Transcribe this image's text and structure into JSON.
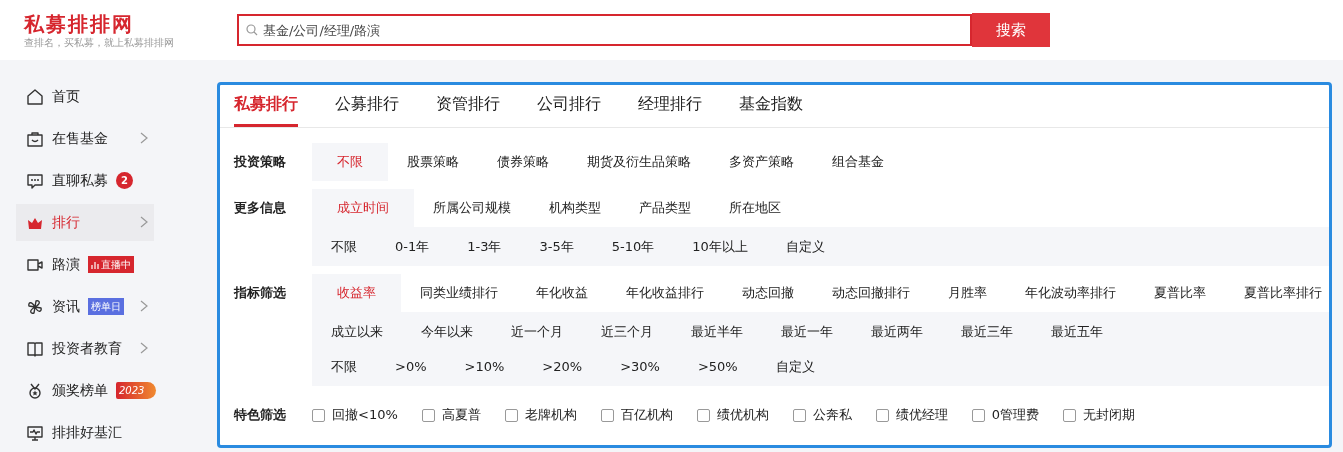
{
  "logo": {
    "title": "私募排排网",
    "slogan": "查排名，买私募，就上私募排排网"
  },
  "search": {
    "placeholder": "基金/公司/经理/路演",
    "button": "搜索"
  },
  "sidebar": {
    "items": [
      {
        "label": "首页",
        "kind": "home",
        "chevron": false,
        "selected": false
      },
      {
        "label": "在售基金",
        "kind": "bag",
        "chevron": true,
        "selected": false
      },
      {
        "label": "直聊私募",
        "kind": "chat",
        "chevron": false,
        "selected": false,
        "badge": {
          "kind": "count",
          "text": "2"
        }
      },
      {
        "label": "排行",
        "kind": "crown",
        "chevron": true,
        "selected": true
      },
      {
        "label": "路演",
        "kind": "camera",
        "chevron": false,
        "selected": false,
        "badge": {
          "kind": "live",
          "text": "直播中"
        }
      },
      {
        "label": "资讯",
        "kind": "pinwheel",
        "chevron": true,
        "selected": false,
        "badge": {
          "kind": "tag",
          "text": "榜单日"
        }
      },
      {
        "label": "投资者教育",
        "kind": "book",
        "chevron": true,
        "selected": false
      },
      {
        "label": "颁奖榜单",
        "kind": "medal",
        "chevron": false,
        "selected": false,
        "badge": {
          "kind": "year",
          "text": "2023"
        }
      },
      {
        "label": "排排好基汇",
        "kind": "monitor",
        "chevron": false,
        "selected": false
      }
    ]
  },
  "tabs": [
    {
      "label": "私募排行",
      "selected": true
    },
    {
      "label": "公募排行",
      "selected": false
    },
    {
      "label": "资管排行",
      "selected": false
    },
    {
      "label": "公司排行",
      "selected": false
    },
    {
      "label": "经理排行",
      "selected": false
    },
    {
      "label": "基金指数",
      "selected": false
    }
  ],
  "filters": [
    {
      "label": "投资策略",
      "options": [
        {
          "label": "不限",
          "selected": true
        },
        {
          "label": "股票策略",
          "selected": false
        },
        {
          "label": "债券策略",
          "selected": false
        },
        {
          "label": "期货及衍生品策略",
          "selected": false
        },
        {
          "label": "多资产策略",
          "selected": false
        },
        {
          "label": "组合基金",
          "selected": false
        }
      ]
    },
    {
      "label": "更多信息",
      "options": [
        {
          "label": "成立时间",
          "selected": true
        },
        {
          "label": "所属公司规模",
          "selected": false
        },
        {
          "label": "机构类型",
          "selected": false
        },
        {
          "label": "产品类型",
          "selected": false
        },
        {
          "label": "所在地区",
          "selected": false
        }
      ],
      "sub_rows": [
        [
          {
            "label": "不限",
            "selected": false
          },
          {
            "label": "0-1年",
            "selected": false
          },
          {
            "label": "1-3年",
            "selected": false
          },
          {
            "label": "3-5年",
            "selected": false
          },
          {
            "label": "5-10年",
            "selected": false
          },
          {
            "label": "10年以上",
            "selected": false
          },
          {
            "label": "自定义",
            "selected": false
          }
        ]
      ]
    },
    {
      "label": "指标筛选",
      "options": [
        {
          "label": "收益率",
          "selected": true
        },
        {
          "label": "同类业绩排行",
          "selected": false
        },
        {
          "label": "年化收益",
          "selected": false
        },
        {
          "label": "年化收益排行",
          "selected": false
        },
        {
          "label": "动态回撤",
          "selected": false
        },
        {
          "label": "动态回撤排行",
          "selected": false
        },
        {
          "label": "月胜率",
          "selected": false
        },
        {
          "label": "年化波动率排行",
          "selected": false
        },
        {
          "label": "夏普比率",
          "selected": false
        },
        {
          "label": "夏普比率排行",
          "selected": false
        }
      ],
      "sub_rows": [
        [
          {
            "label": "成立以来",
            "selected": false
          },
          {
            "label": "今年以来",
            "selected": false
          },
          {
            "label": "近一个月",
            "selected": false
          },
          {
            "label": "近三个月",
            "selected": false
          },
          {
            "label": "最近半年",
            "selected": false
          },
          {
            "label": "最近一年",
            "selected": false
          },
          {
            "label": "最近两年",
            "selected": false
          },
          {
            "label": "最近三年",
            "selected": false
          },
          {
            "label": "最近五年",
            "selected": false
          }
        ],
        [
          {
            "label": "不限",
            "selected": false
          },
          {
            "label": ">0%",
            "selected": false
          },
          {
            "label": ">10%",
            "selected": false
          },
          {
            "label": ">20%",
            "selected": false
          },
          {
            "label": ">30%",
            "selected": false
          },
          {
            "label": ">50%",
            "selected": false
          },
          {
            "label": "自定义",
            "selected": false
          }
        ]
      ]
    }
  ],
  "features": {
    "label": "特色筛选",
    "items": [
      {
        "label": "回撤<10%",
        "checked": false
      },
      {
        "label": "高夏普",
        "checked": false
      },
      {
        "label": "老牌机构",
        "checked": false
      },
      {
        "label": "百亿机构",
        "checked": false
      },
      {
        "label": "绩优机构",
        "checked": false
      },
      {
        "label": "公奔私",
        "checked": false
      },
      {
        "label": "绩优经理",
        "checked": false
      },
      {
        "label": "0管理费",
        "checked": false
      },
      {
        "label": "无封闭期",
        "checked": false
      }
    ]
  }
}
